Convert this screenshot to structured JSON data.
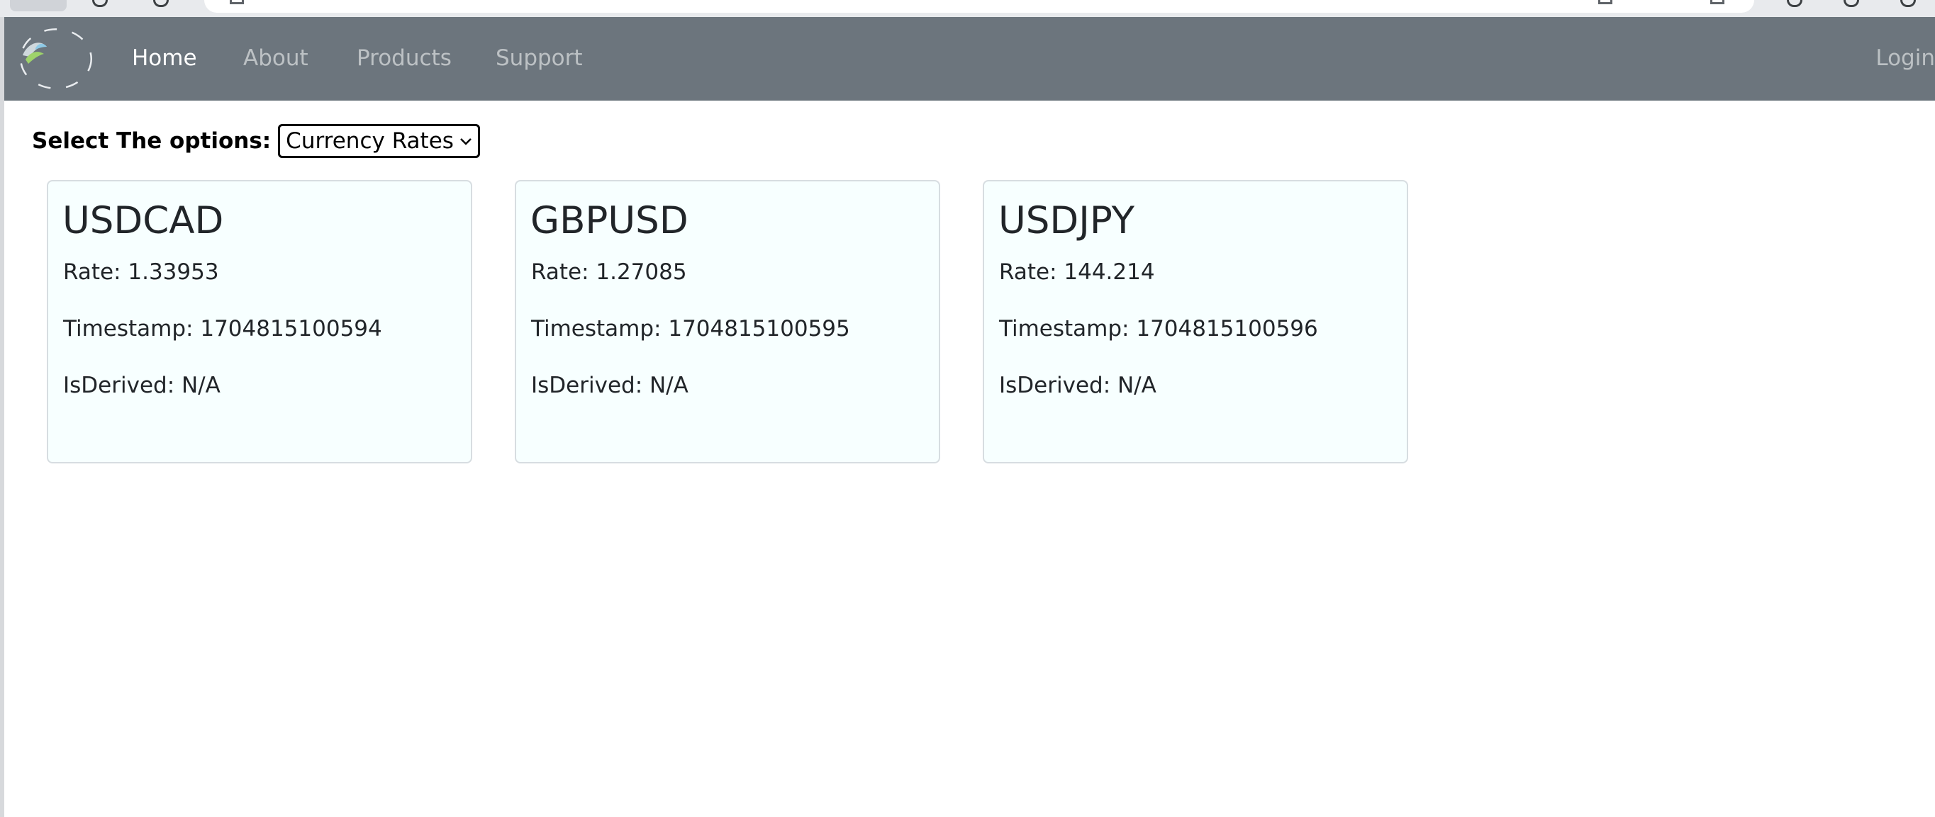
{
  "navbar": {
    "brand_icon": "logo-circle-icon",
    "links": [
      "Home",
      "About",
      "Products",
      "Support"
    ],
    "active_link": "Home",
    "login_label": "Login",
    "background_color": "#6c757d"
  },
  "options": {
    "label": "Select The options:",
    "selected_value": "Currency Rates"
  },
  "cards": [
    {
      "title": "USDCAD",
      "rate": "Rate: 1.33953",
      "timestamp": "Timestamp: 1704815100594",
      "is_derived": "IsDerived: N/A"
    },
    {
      "title": "GBPUSD",
      "rate": "Rate: 1.27085",
      "timestamp": "Timestamp: 1704815100595",
      "is_derived": "IsDerived: N/A"
    },
    {
      "title": "USDJPY",
      "rate": "Rate: 144.214",
      "timestamp": "Timestamp: 1704815100596",
      "is_derived": "IsDerived: N/A"
    }
  ],
  "colors": {
    "card_background": "#f7ffff",
    "card_border": "#d7dde1",
    "nav_active_text": "#ffffff",
    "nav_inactive_text": "rgba(255,255,255,0.55)"
  }
}
